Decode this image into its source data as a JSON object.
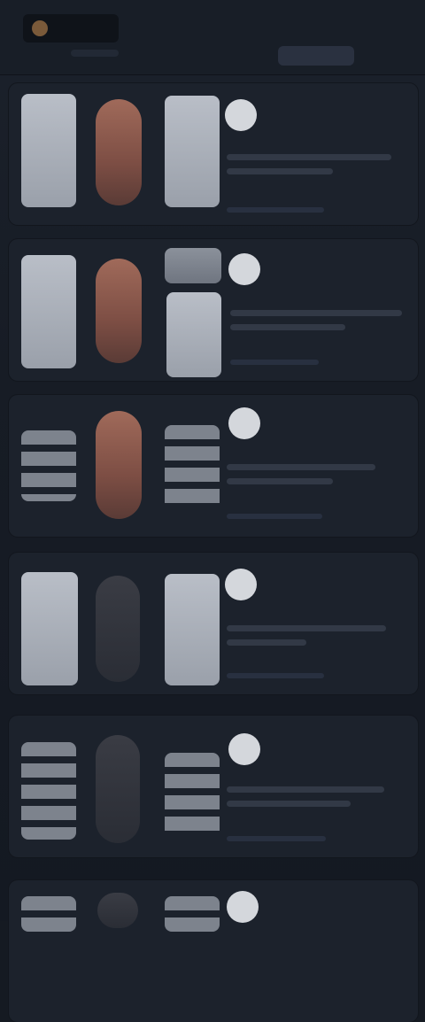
{
  "header": {
    "brand": "",
    "action_label": ""
  },
  "feed": {
    "items": [
      {
        "title": ""
      },
      {
        "title": ""
      },
      {
        "title": ""
      },
      {
        "title": ""
      },
      {
        "title": ""
      },
      {
        "title": ""
      }
    ]
  }
}
